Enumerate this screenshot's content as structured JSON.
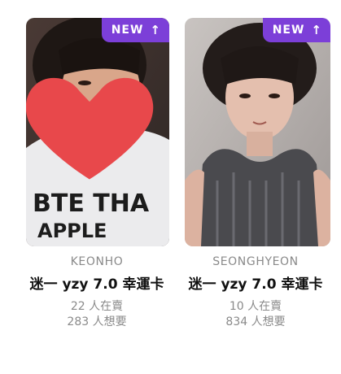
{
  "cards": [
    {
      "badge": "NEW",
      "badge_icon": "arrow-up-icon",
      "member": "KEONHO",
      "title": "迷一 yzy 7.0 幸運卡",
      "selling": "22 人在賣",
      "wanting": "283 人想要",
      "favorited": true,
      "heart_color": "#e8484b"
    },
    {
      "badge": "NEW",
      "badge_icon": "arrow-up-icon",
      "member": "SEONGHYEON",
      "title": "迷一 yzy 7.0 幸運卡",
      "selling": "10 人在賣",
      "wanting": "834 人想要",
      "favorited": false
    }
  ],
  "colors": {
    "badge_bg": "#7c3fd8",
    "muted_text": "#8a8a8a",
    "title_text": "#111111"
  }
}
